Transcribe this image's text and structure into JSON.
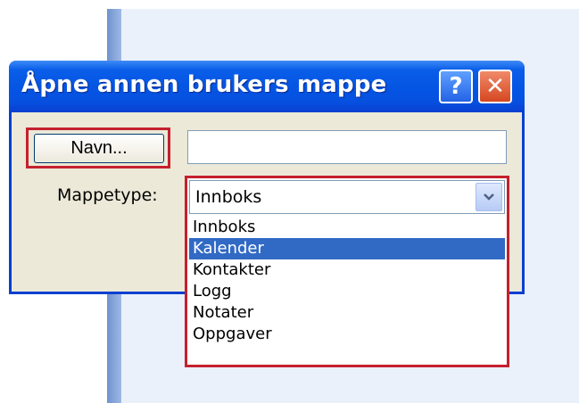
{
  "dialog": {
    "title": "Åpne annen brukers mappe",
    "help_label": "?",
    "close_label": "✕",
    "name_button_label": "Navn...",
    "name_input_value": "",
    "folder_type_label": "Mappetype:",
    "folder_type_selected": "Innboks",
    "folder_type_options": [
      {
        "label": "Innboks",
        "highlighted": false
      },
      {
        "label": "Kalender",
        "highlighted": true
      },
      {
        "label": "Kontakter",
        "highlighted": false
      },
      {
        "label": "Logg",
        "highlighted": false
      },
      {
        "label": "Notater",
        "highlighted": false
      },
      {
        "label": "Oppgaver",
        "highlighted": false
      }
    ]
  },
  "icons": {
    "help": "help-icon",
    "close": "close-icon",
    "dropdown": "chevron-down-icon"
  },
  "colors": {
    "titlebar": "#0554e3",
    "annotation_highlight": "#c5202e",
    "selected_option": "#316ac5",
    "dialog_face": "#ece9d8"
  }
}
